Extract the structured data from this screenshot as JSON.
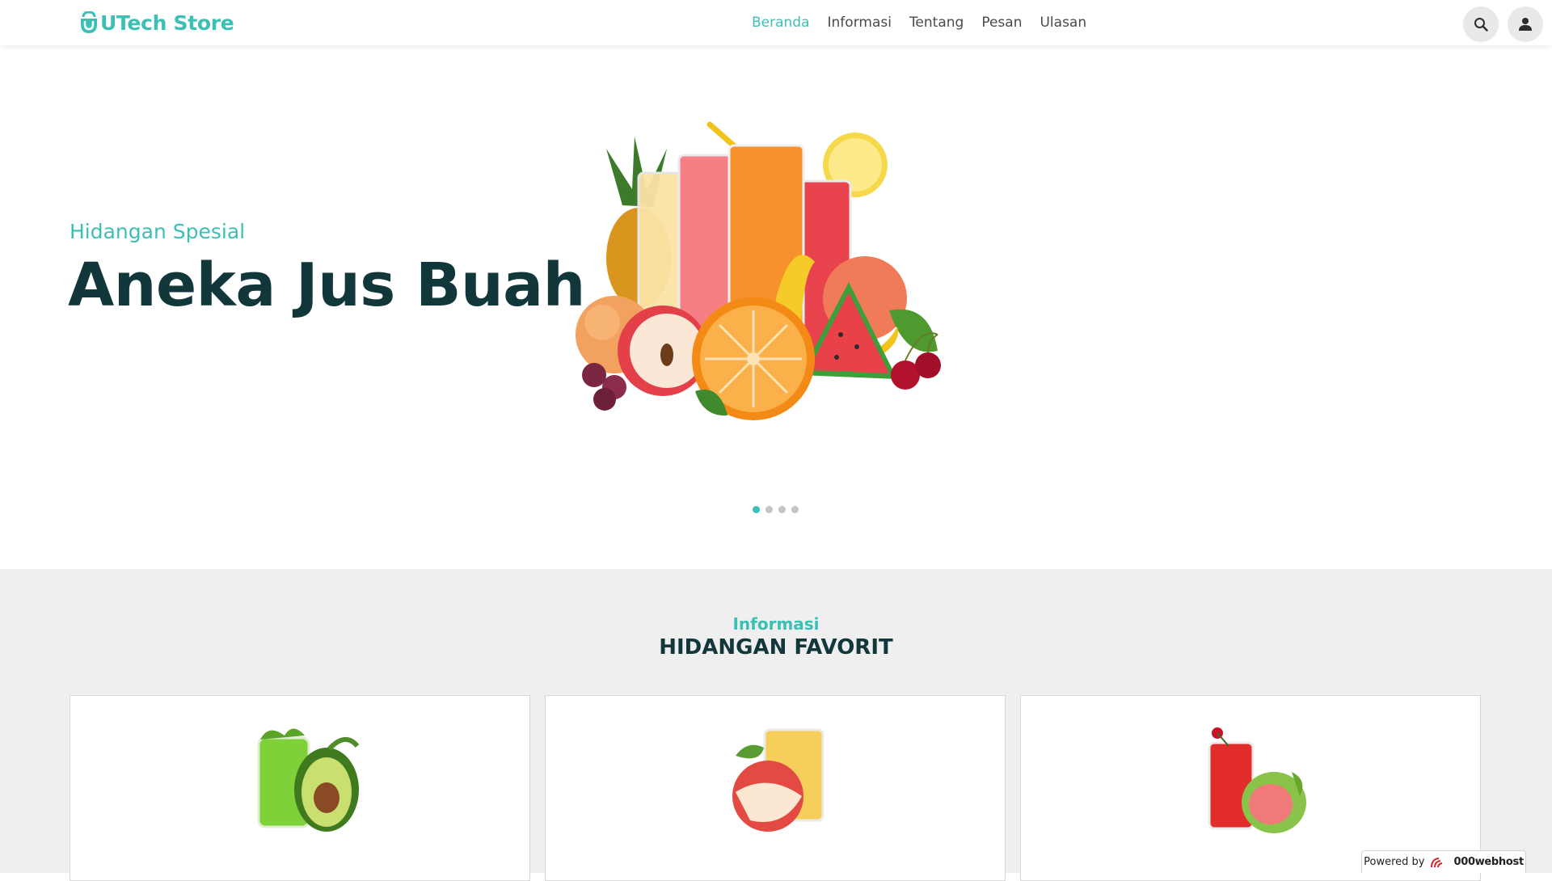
{
  "header": {
    "brand": "UTech Store",
    "nav": [
      {
        "label": "Beranda",
        "active": true
      },
      {
        "label": "Informasi",
        "active": false
      },
      {
        "label": "Tentang",
        "active": false
      },
      {
        "label": "Pesan",
        "active": false
      },
      {
        "label": "Ulasan",
        "active": false
      }
    ],
    "icons": [
      "search-icon",
      "user-icon"
    ]
  },
  "hero": {
    "subtitle": "Hidangan Spesial",
    "title": "Aneka Jus Buah",
    "carousel": {
      "slides": 4,
      "active_index": 0
    }
  },
  "favorites": {
    "label": "Informasi",
    "heading": "HIDANGAN FAVORIT",
    "cards": [
      {
        "image": "avocado-juice"
      },
      {
        "image": "apple-juice"
      },
      {
        "image": "guava-juice"
      }
    ]
  },
  "badge": {
    "powered": "Powered by",
    "host": "000webhost"
  },
  "colors": {
    "accent": "#3cbfb4",
    "heading": "#12373a",
    "section_bg": "#efefef"
  }
}
